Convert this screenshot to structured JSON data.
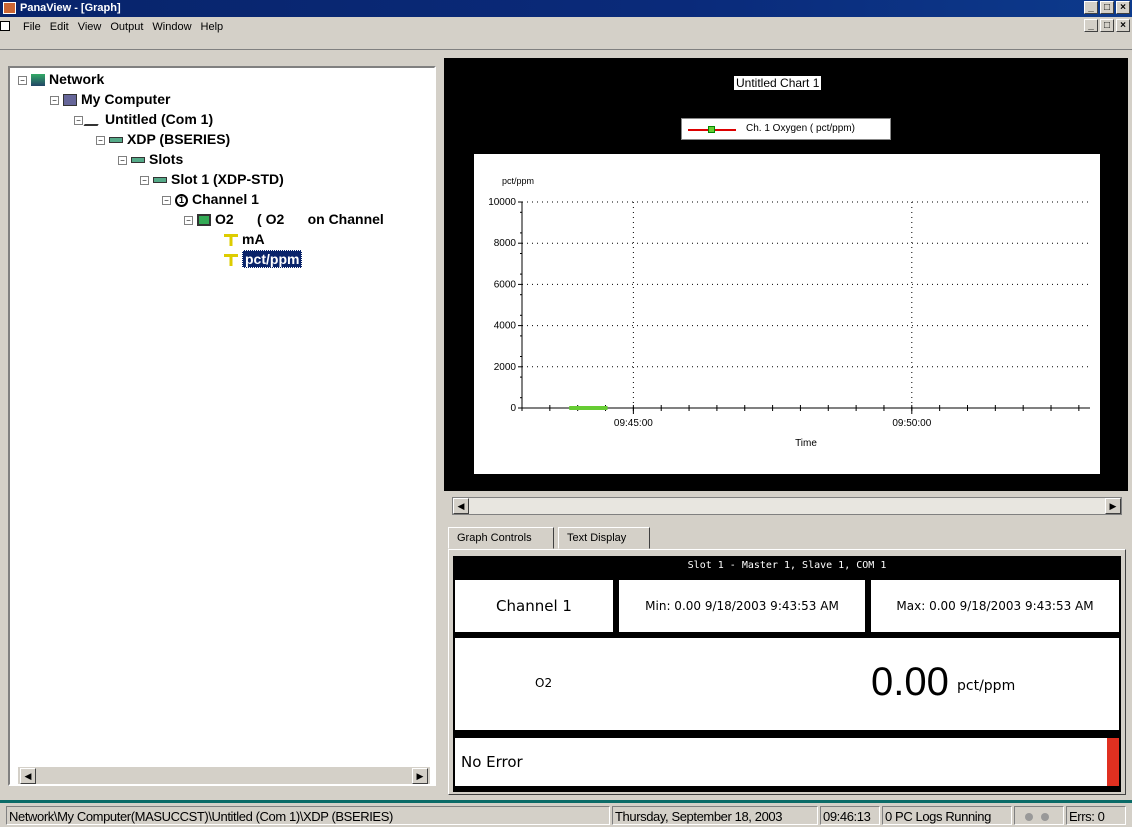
{
  "window": {
    "title": "PanaView - [Graph]"
  },
  "menu": [
    "File",
    "Edit",
    "View",
    "Output",
    "Window",
    "Help"
  ],
  "tree": [
    {
      "label": "Network",
      "level": 0,
      "icon": "network-icon"
    },
    {
      "label": "My Computer",
      "level": 1,
      "icon": "computer-icon"
    },
    {
      "label": "Untitled (Com 1)",
      "level": 2,
      "icon": "serial-port-icon"
    },
    {
      "label": "XDP (BSERIES)",
      "level": 3,
      "icon": "device-icon"
    },
    {
      "label": "Slots",
      "level": 4,
      "icon": "slots-icon"
    },
    {
      "label": "Slot 1 (XDP-STD)",
      "level": 5,
      "icon": "slot-icon"
    },
    {
      "label": "Channel 1",
      "level": 6,
      "icon": "channel-number-icon"
    },
    {
      "label": "O2      ( O2      on Channel",
      "level": 7,
      "icon": "sensor-icon"
    },
    {
      "label": "mA",
      "level": 8,
      "icon": "unit-icon"
    },
    {
      "label": "pct/ppm",
      "level": 8,
      "icon": "unit-icon",
      "selected": true
    }
  ],
  "chart_data": {
    "type": "line",
    "title": "Untitled Chart 1",
    "ylabel": "pct/ppm",
    "xlabel": "Time",
    "ylim": [
      0,
      10000
    ],
    "yticks": [
      "0",
      "2000",
      "4000",
      "6000",
      "8000",
      "10000"
    ],
    "xticks": [
      "09:45:00",
      "09:50:00"
    ],
    "grid": true,
    "legend_position": "top-center",
    "series": [
      {
        "name": "Ch. 1 Oxygen ( pct/ppm)",
        "color": "#66cc33",
        "x": [
          "09:43:53",
          "09:44:30"
        ],
        "values": [
          0,
          0
        ]
      }
    ]
  },
  "tabs": [
    "Graph Controls",
    "Text Display"
  ],
  "text_display": {
    "header": "Slot 1 - Master 1, Slave 1, COM 1",
    "channel": "Channel 1",
    "min": "Min: 0.00  9/18/2003 9:43:53 AM",
    "max": "Max: 0.00  9/18/2003 9:43:53 AM",
    "param": "O2",
    "value": "0.00",
    "unit": "pct/ppm",
    "error": "No Error",
    "error_color": "#e03020"
  },
  "status": {
    "path": "Network\\My Computer(MASUCCST)\\Untitled (Com 1)\\XDP (BSERIES)",
    "date": "Thursday, September 18, 2003",
    "time": "09:46:13",
    "logs": "0 PC Logs Running",
    "errs": "Errs: 0"
  }
}
